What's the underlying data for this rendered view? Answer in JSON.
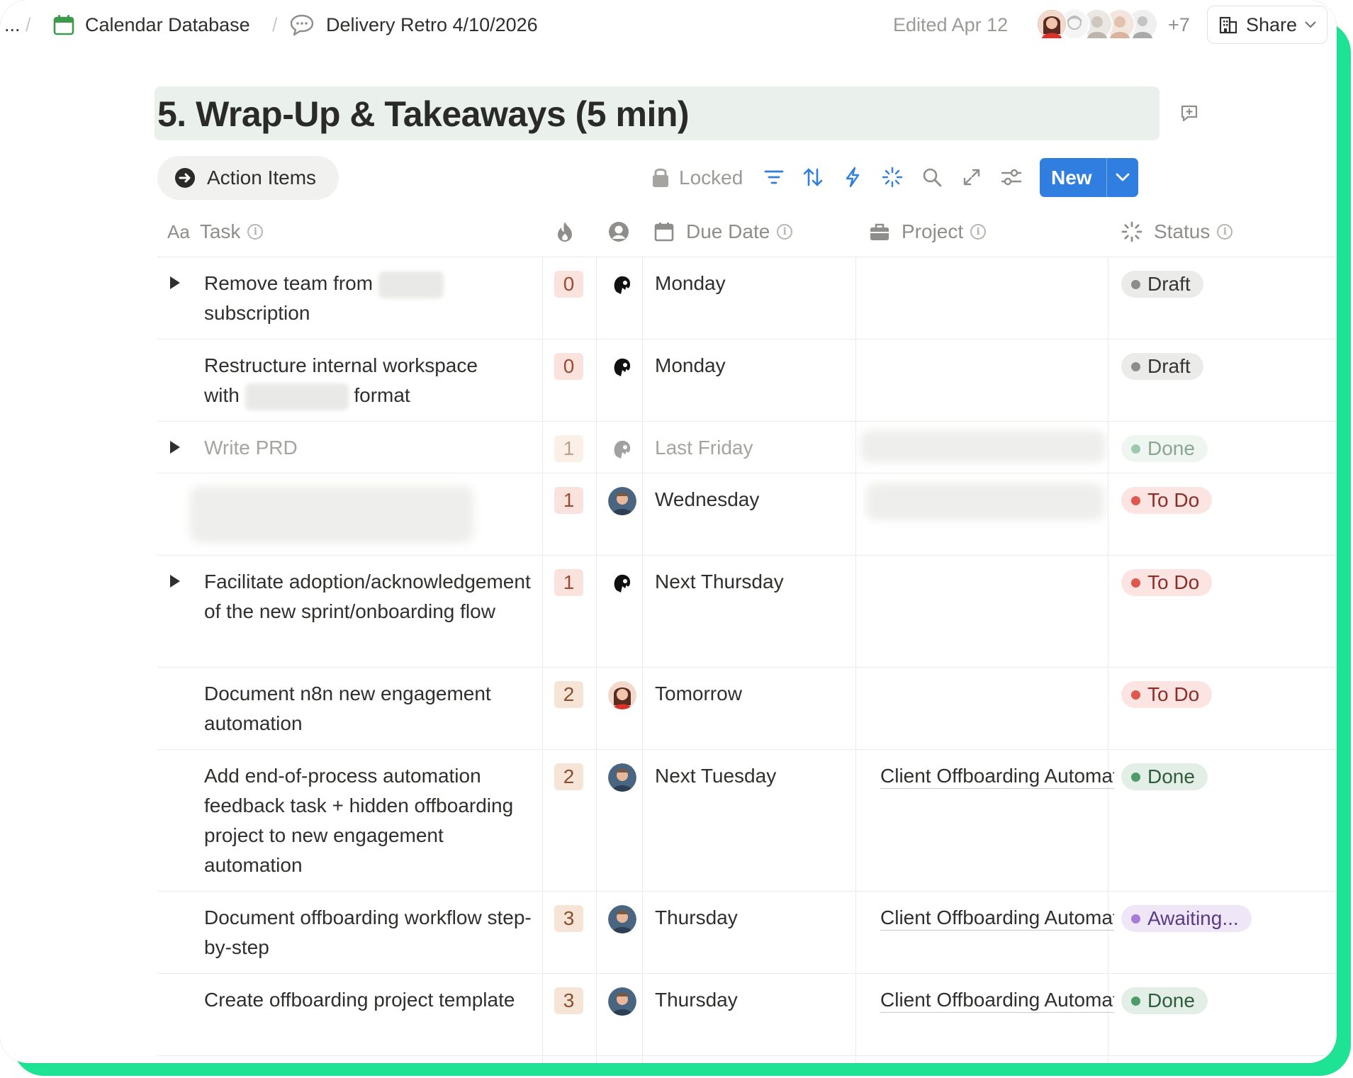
{
  "breadcrumb": {
    "ellipsis": "...",
    "separator": "/",
    "database": "Calendar Database",
    "page": "Delivery Retro 4/10/2026"
  },
  "topbar": {
    "edited": "Edited Apr 12",
    "extra_collaborators": "+7",
    "share_label": "Share"
  },
  "page": {
    "title": "5. Wrap-Up & Takeaways (5 min)"
  },
  "view": {
    "tab_label": "Action Items",
    "locked_label": "Locked",
    "new_label": "New"
  },
  "columns": {
    "task": "Task",
    "task_icon_text": "Aa",
    "due": "Due Date",
    "project": "Project",
    "status": "Status"
  },
  "rows": [
    {
      "task": "Remove team from",
      "task_tail": "subscription",
      "priority": "0",
      "due": "Monday",
      "project": "",
      "status": "Draft"
    },
    {
      "task": "Restructure internal workspace",
      "task_tail_pre": "with",
      "task_tail_post": "format",
      "priority": "0",
      "due": "Monday",
      "project": "",
      "status": "Draft"
    },
    {
      "task": "Write PRD",
      "priority": "1",
      "due": "Last Friday",
      "project": "",
      "status": "Done"
    },
    {
      "task": "",
      "priority": "1",
      "due": "Wednesday",
      "project": "",
      "status": "To Do"
    },
    {
      "task": "Facilitate adoption/acknowledgement of the new sprint/onboarding flow",
      "priority": "1",
      "due": "Next Thursday",
      "project": "",
      "status": "To Do"
    },
    {
      "task": "Document n8n new engagement automation",
      "priority": "2",
      "due": "Tomorrow",
      "project": "",
      "status": "To Do"
    },
    {
      "task": "Add end-of-process automation feedback task + hidden offboarding project to new engagement automation",
      "priority": "2",
      "due": "Next Tuesday",
      "project": "Client Offboarding Automation",
      "status": "Done"
    },
    {
      "task": "Document offboarding workflow step-by-step",
      "priority": "3",
      "due": "Thursday",
      "project": "Client Offboarding Automation",
      "status": "Awaiting..."
    },
    {
      "task": "Create offboarding project template",
      "priority": "3",
      "due": "Thursday",
      "project": "Client Offboarding Automation",
      "status": "Done"
    }
  ],
  "colors": {
    "accent_frame": "#1fe394",
    "new_button": "#2f7ee0",
    "draft_bg": "#ebebea",
    "draft_dot": "#8e8d89",
    "done_bg": "#e3efe6",
    "done_dot": "#4f9b6a",
    "todo_bg": "#fbe4e2",
    "todo_dot": "#e0574f",
    "awaiting_bg": "#efe7f8",
    "awaiting_dot": "#a77bd8",
    "priority_bg": "#f6e4d7",
    "title_highlight": "#eaf1ec"
  },
  "icons": {
    "calendar": "calendar-icon",
    "chat": "speech-bubble-icon",
    "share": "building-icon",
    "comment": "add-comment-icon",
    "view": "arrow-circle-icon",
    "lock": "lock-icon",
    "filter": "filter-icon",
    "sort": "sort-icon",
    "automation": "lightning-icon",
    "ai": "sparkle-icon",
    "search": "search-icon",
    "expand": "expand-icon",
    "settings": "sliders-icon",
    "priority": "flame-icon",
    "person": "person-icon",
    "due": "calendar-icon",
    "project": "briefcase-icon",
    "status": "status-spinner-icon",
    "doc": "document-icon"
  }
}
